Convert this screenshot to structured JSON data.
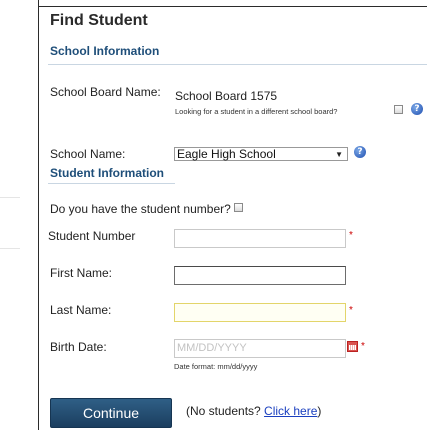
{
  "page": {
    "title": "Find Student"
  },
  "school_info": {
    "heading": "School Information",
    "board_label": "School Board Name:",
    "board_value": "School Board 1575",
    "different_board_text": "Looking for a student in a different school board?",
    "school_label": "School Name:",
    "school_selected": "Eagle High School"
  },
  "student_info": {
    "heading": "Student Information",
    "have_number_label": "Do you have the student number?",
    "student_number_label": "Student Number",
    "first_name_label": "First Name:",
    "last_name_label": "Last Name:",
    "birth_date_label": "Birth Date:",
    "birth_date_placeholder": "MM/DD/YYYY",
    "date_format_hint": "Date format: mm/dd/yyyy",
    "required_marker": "*"
  },
  "actions": {
    "continue_label": "Continue",
    "no_students_prefix": "(No students? ",
    "click_here_label": "Click here",
    "no_students_suffix": ")"
  },
  "icons": {
    "help": "help-icon",
    "calendar": "calendar-icon",
    "dropdown": "chevron-down-icon"
  },
  "colors": {
    "section_heading": "#1e4e79",
    "button_bg": "#1b3e5f",
    "required": "#cc0000",
    "link": "#1a3fbf",
    "highlight_field": "#fffff3"
  }
}
